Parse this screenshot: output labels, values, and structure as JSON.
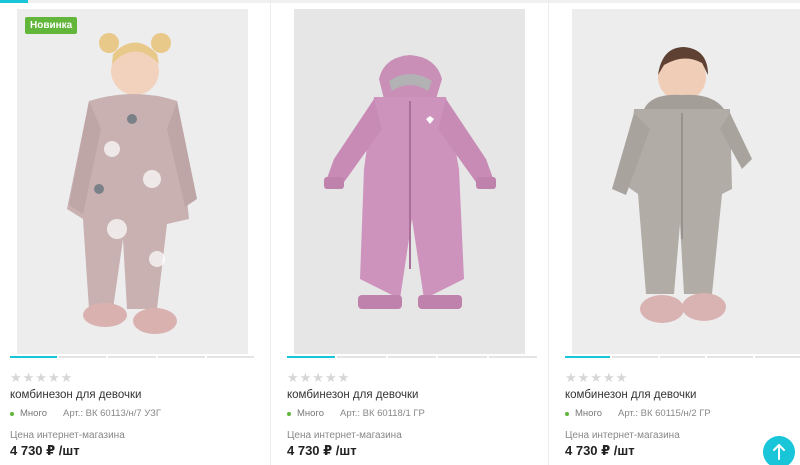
{
  "colors": {
    "accent": "#19c5d8",
    "badge": "#62b63a",
    "stock_dot": "#62b63a"
  },
  "products": [
    {
      "badge": "Новинка",
      "stars": "★★★★★",
      "title": "комбинезон для девочки",
      "stock": "Много",
      "article": "Арт.: ВК 60113/н/7 УЗГ",
      "price_label": "Цена интернет-магазина",
      "price": "4 730 ₽ /шт"
    },
    {
      "stars": "★★★★★",
      "title": "комбинезон для девочки",
      "stock": "Много",
      "article": "Арт.: ВК 60118/1 ГР",
      "price_label": "Цена интернет-магазина",
      "price": "4 730 ₽ /шт"
    },
    {
      "stars": "★★★★★",
      "title": "комбинезон для девочки",
      "stock": "Много",
      "article": "Арт.: ВК 60115/н/2 ГР",
      "price_label": "Цена интернет-магазина",
      "price": "4 730 ₽ /шт"
    }
  ],
  "scroll_top_icon": "arrow-up-icon"
}
